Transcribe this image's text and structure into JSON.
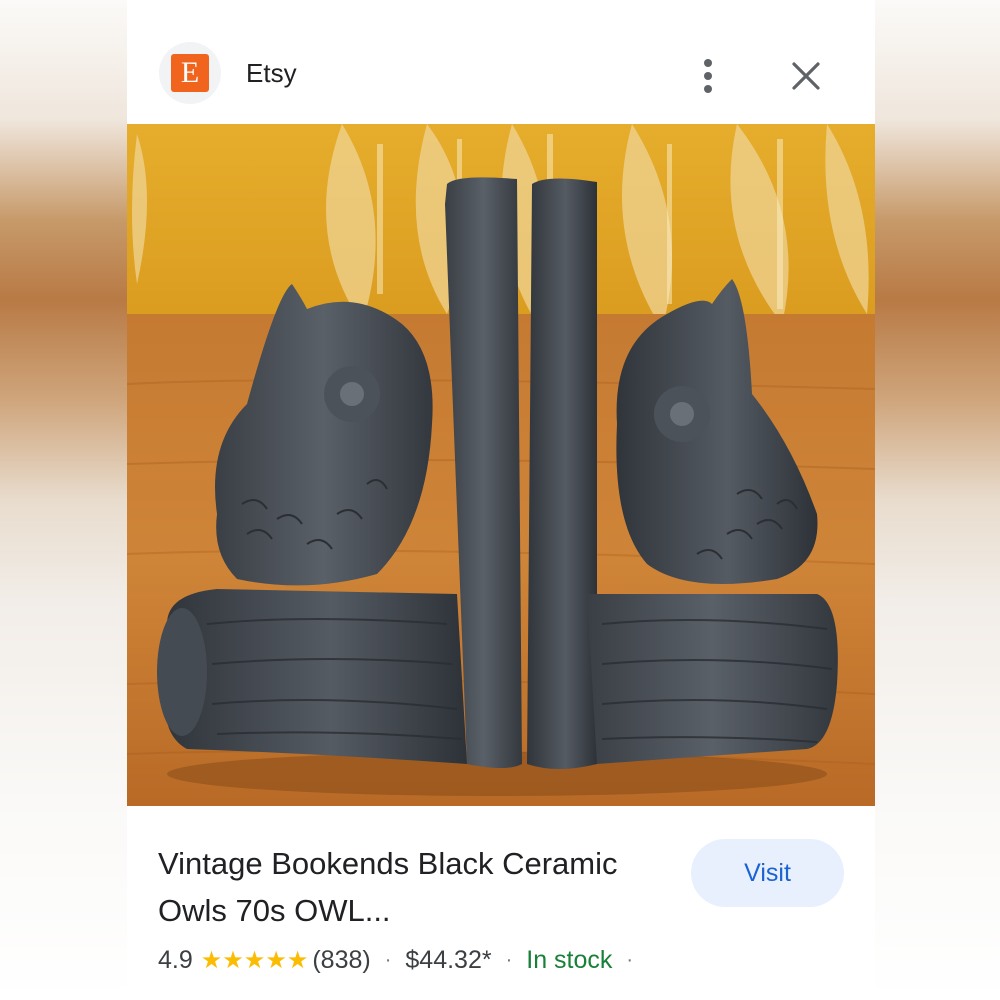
{
  "header": {
    "site_icon_letter": "E",
    "site_name": "Etsy",
    "menu_icon": "more-vert-icon",
    "close_icon": "close-icon"
  },
  "image": {
    "description_icon": "product-photo",
    "subject": "owl bookends"
  },
  "product": {
    "title": "Vintage Bookends Black Ceramic Owls 70s OWL...",
    "visit_label": "Visit",
    "rating": "4.9",
    "stars": "★★★★★",
    "review_count": "(838)",
    "price": "$44.32*",
    "availability": "In stock",
    "separator": "·"
  },
  "colors": {
    "brand": "#f1641e",
    "visit_bg": "#e8f0fe",
    "visit_text": "#1a63d3",
    "stars": "#fbbc04",
    "in_stock": "#188038"
  }
}
